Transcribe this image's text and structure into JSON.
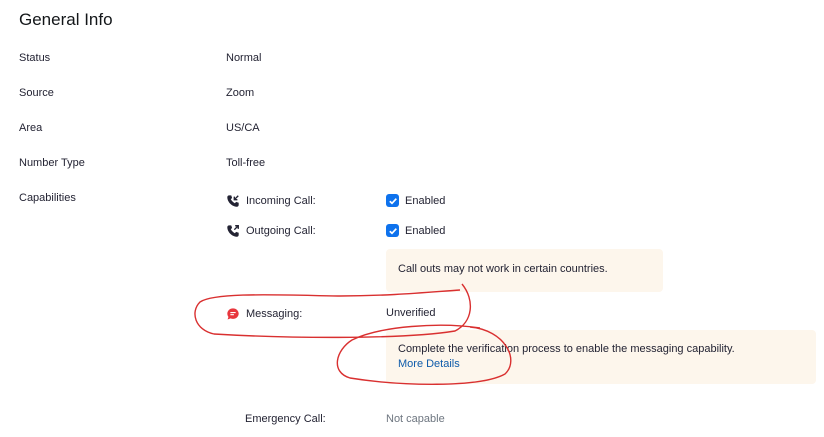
{
  "section": {
    "title": "General Info"
  },
  "fields": {
    "status": {
      "label": "Status",
      "value": "Normal"
    },
    "source": {
      "label": "Source",
      "value": "Zoom"
    },
    "area": {
      "label": "Area",
      "value": "US/CA"
    },
    "number_type": {
      "label": "Number Type",
      "value": "Toll-free"
    },
    "capabilities": {
      "label": "Capabilities"
    }
  },
  "capabilities": {
    "incoming": {
      "label": "Incoming Call:",
      "value": "Enabled",
      "icon": "incoming-call-icon"
    },
    "outgoing": {
      "label": "Outgoing Call:",
      "value": "Enabled",
      "icon": "outgoing-call-icon"
    },
    "outgoing_notice": "Call outs may not work in certain countries.",
    "messaging": {
      "label": "Messaging:",
      "value": "Unverified",
      "icon": "messaging-icon"
    },
    "messaging_notice": "Complete the verification process to enable the messaging capability.",
    "messaging_link": "More Details",
    "emergency": {
      "label": "Emergency Call:",
      "value": "Not capable"
    }
  },
  "colors": {
    "accent": "#0e72ed",
    "link": "#0e5baa",
    "notice_bg": "#fdf6ec",
    "messaging_icon": "#e8363d",
    "annotation": "#d93030"
  }
}
